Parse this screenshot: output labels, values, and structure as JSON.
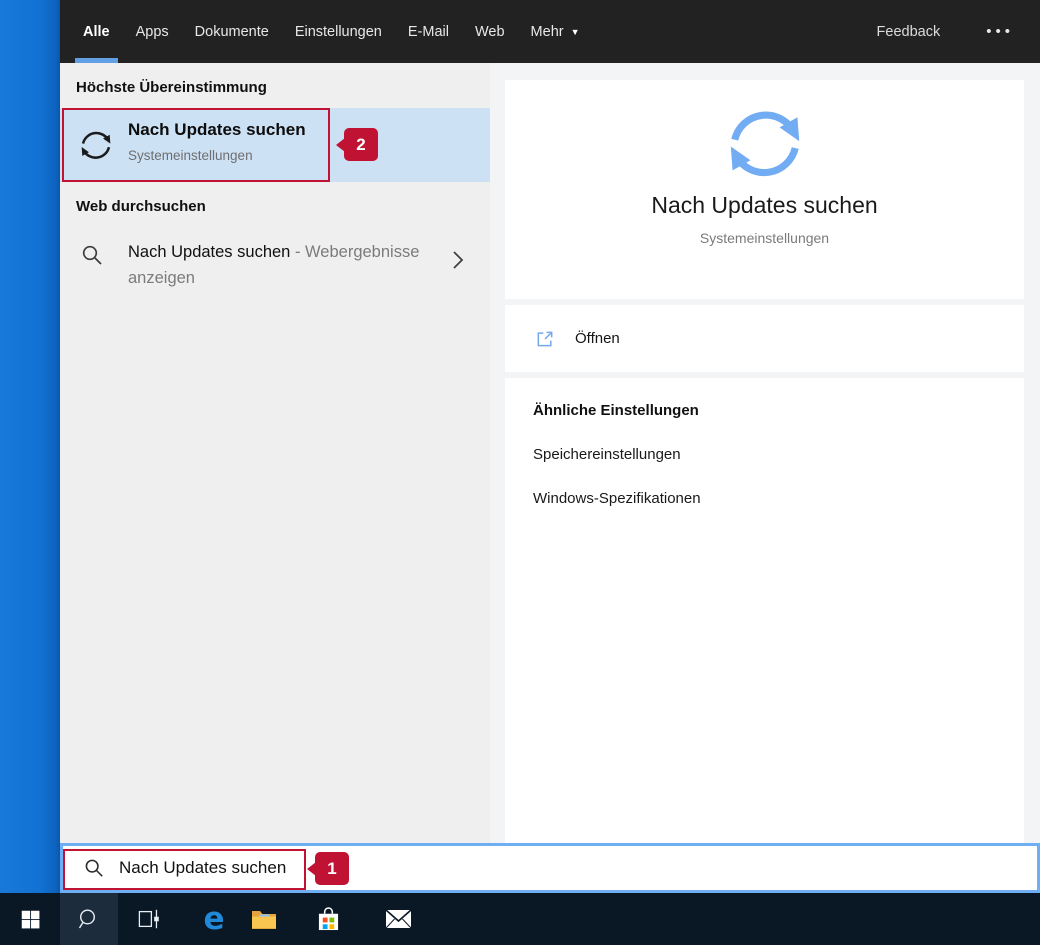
{
  "topbar": {
    "tabs": [
      {
        "label": "Alle",
        "active": true
      },
      {
        "label": "Apps",
        "active": false
      },
      {
        "label": "Dokumente",
        "active": false
      },
      {
        "label": "Einstellungen",
        "active": false
      },
      {
        "label": "E-Mail",
        "active": false
      },
      {
        "label": "Web",
        "active": false
      },
      {
        "label": "Mehr",
        "active": false
      }
    ],
    "mehr_arrow": "▼",
    "feedback_label": "Feedback",
    "more_options": "•••"
  },
  "left_panel": {
    "best_match_header": "Höchste Übereinstimmung",
    "best_match": {
      "title": "Nach Updates suchen",
      "subtitle": "Systemeinstellungen"
    },
    "web_header": "Web durchsuchen",
    "web_item": {
      "query": "Nach Updates suchen",
      "suffix": " - Webergebnisse anzeigen"
    }
  },
  "preview_panel": {
    "title": "Nach Updates suchen",
    "subtitle": "Systemeinstellungen",
    "open_label": "Öffnen",
    "related_header": "Ähnliche Einstellungen",
    "related_items": [
      "Speichereinstellungen",
      "Windows-Spezifikationen"
    ]
  },
  "search_bar": {
    "value": "Nach Updates suchen"
  },
  "annotations": {
    "step1": "1",
    "step2": "2"
  },
  "icons": {
    "edge_glyph": "e"
  },
  "colors": {
    "accent_blue": "#1272d4",
    "tab_underline_blue": "#61A0E4",
    "highlight_row_blue": "#cde1f5",
    "marker_red": "#C01334",
    "search_border_blue": "#6FAEF2",
    "sync_icon_blue": "#72ACF3",
    "taskbar_dark": "#0A1724"
  }
}
